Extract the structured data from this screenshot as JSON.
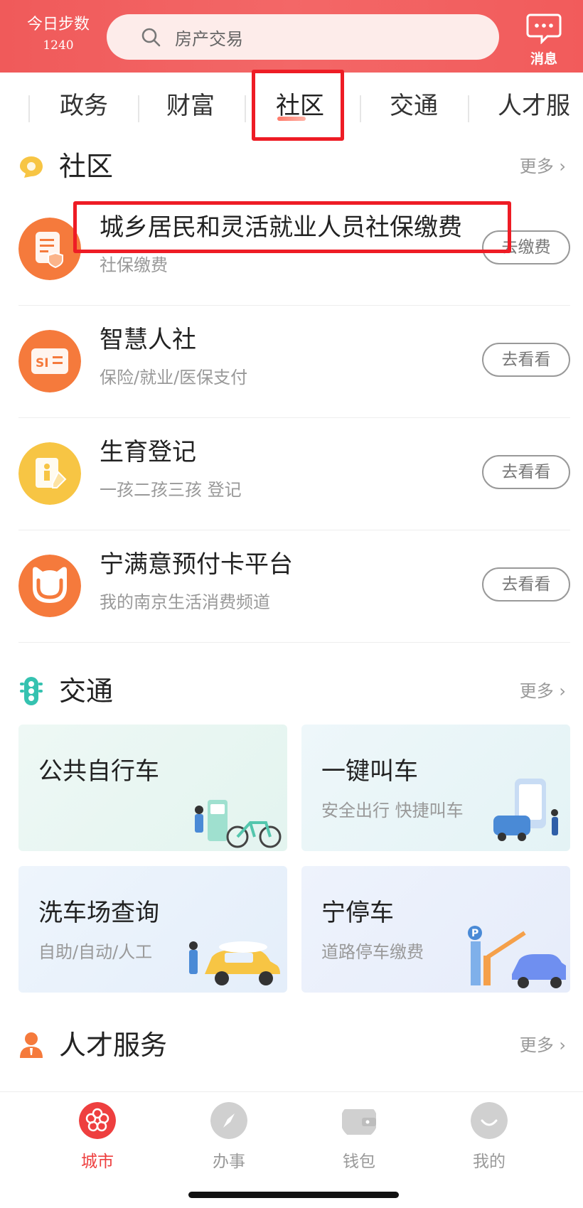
{
  "header": {
    "steps_label": "今日步数",
    "steps_count": "1240",
    "search_placeholder": "房产交易",
    "message_label": "消息"
  },
  "tabs": [
    {
      "label": "政务"
    },
    {
      "label": "财富"
    },
    {
      "label": "社区",
      "active": true
    },
    {
      "label": "交通"
    },
    {
      "label": "人才服"
    }
  ],
  "community": {
    "title": "社区",
    "more": "更多",
    "items": [
      {
        "name": "城乡居民和灵活就业人员社保缴费",
        "sub": "社保缴费",
        "button": "去缴费",
        "icon": "document-shield-icon"
      },
      {
        "name": "智慧人社",
        "sub": "保险/就业/医保支付",
        "button": "去看看",
        "icon": "si-card-icon"
      },
      {
        "name": "生育登记",
        "sub": "一孩二孩三孩 登记",
        "button": "去看看",
        "icon": "register-pen-icon"
      },
      {
        "name": "宁满意预付卡平台",
        "sub": "我的南京生活消费频道",
        "button": "去看看",
        "icon": "smile-face-icon"
      }
    ]
  },
  "traffic": {
    "title": "交通",
    "more": "更多",
    "cards": [
      {
        "title": "公共自行车",
        "sub": ""
      },
      {
        "title": "一键叫车",
        "sub": "安全出行 快捷叫车"
      },
      {
        "title": "洗车场查询",
        "sub": "自助/自动/人工"
      },
      {
        "title": "宁停车",
        "sub": "道路停车缴费"
      }
    ]
  },
  "talent": {
    "title": "人才服务",
    "more": "更多"
  },
  "bottom_nav": [
    {
      "label": "城市",
      "active": true
    },
    {
      "label": "办事"
    },
    {
      "label": "钱包"
    },
    {
      "label": "我的"
    }
  ],
  "colors": {
    "brand_red": "#f05a5a",
    "highlight_box": "#ee1c25",
    "orange_icon": "#f57a3c",
    "yellow_icon": "#f7c544"
  }
}
